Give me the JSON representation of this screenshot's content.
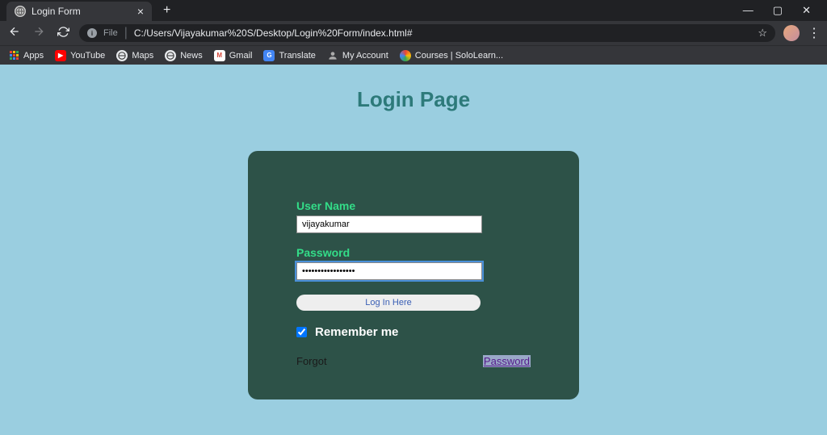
{
  "browser": {
    "tab_title": "Login Form",
    "address_scheme": "File",
    "address_url": "C:/Users/Vijayakumar%20S/Desktop/Login%20Form/index.html#"
  },
  "bookmarks": {
    "apps": "Apps",
    "youtube": "YouTube",
    "maps": "Maps",
    "news": "News",
    "gmail": "Gmail",
    "translate": "Translate",
    "myaccount": "My Account",
    "courses": "Courses | SoloLearn..."
  },
  "page": {
    "title": "Login Page",
    "username_label": "User Name",
    "username_value": "vijayakumar",
    "password_label": "Password",
    "password_value": "myStrongPassword!",
    "login_button": "Log In Here",
    "remember_label": "Remember me",
    "forgot_text": "Forgot",
    "forgot_link": "Password"
  }
}
